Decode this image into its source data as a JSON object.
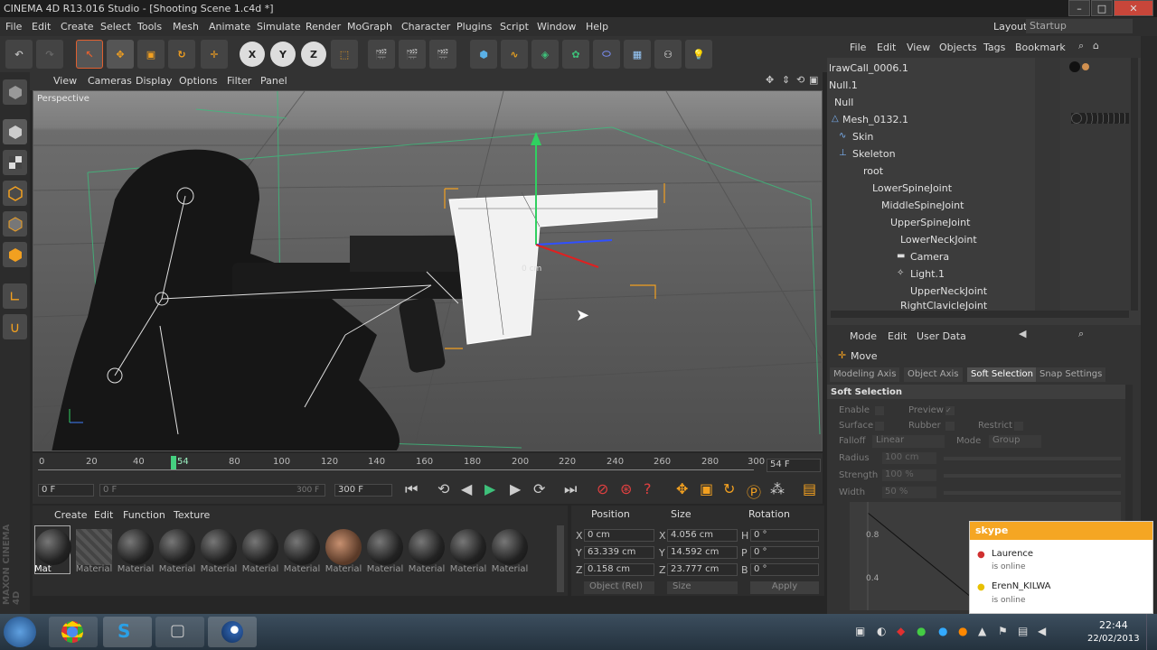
{
  "window": {
    "title": "CINEMA 4D R13.016 Studio - [Shooting Scene 1.c4d *]",
    "layout_label": "Layout:",
    "layout_value": "Startup"
  },
  "menu": [
    "File",
    "Edit",
    "Create",
    "Select",
    "Tools",
    "Mesh",
    "Animate",
    "Simulate",
    "Render",
    "MoGraph",
    "Character",
    "Plugins",
    "Script",
    "Window",
    "Help"
  ],
  "toolbar": {
    "axis_x": "X",
    "axis_y": "Y",
    "axis_z": "Z"
  },
  "viewport": {
    "menu": [
      "View",
      "Cameras",
      "Display",
      "Options",
      "Filter",
      "Panel"
    ],
    "label": "Perspective",
    "gizmo_readout": "0 cm"
  },
  "timeline": {
    "ticks": [
      "0",
      "20",
      "40",
      "54",
      "80",
      "100",
      "120",
      "140",
      "160",
      "180",
      "200",
      "220",
      "240",
      "260",
      "280",
      "300"
    ],
    "current_frame": "54 F"
  },
  "transport": {
    "start": "0 F",
    "range_start": "0 F",
    "range_end": "300 F",
    "end": "300 F"
  },
  "materials": {
    "menu": [
      "Create",
      "Edit",
      "Function",
      "Texture"
    ],
    "items": [
      "Mat",
      "Material",
      "Material",
      "Material",
      "Material",
      "Material",
      "Material",
      "Material",
      "Material",
      "Material",
      "Material",
      "Material"
    ]
  },
  "coords": {
    "headers": [
      "Position",
      "Size",
      "Rotation"
    ],
    "rows": [
      {
        "axis": "X",
        "pos": "0 cm",
        "size_axis": "X",
        "size": "4.056 cm",
        "rot_axis": "H",
        "rot": "0 °"
      },
      {
        "axis": "Y",
        "pos": "63.339 cm",
        "size_axis": "Y",
        "size": "14.592 cm",
        "rot_axis": "P",
        "rot": "0 °"
      },
      {
        "axis": "Z",
        "pos": "0.158 cm",
        "size_axis": "Z",
        "size": "23.777 cm",
        "rot_axis": "B",
        "rot": "0 °"
      }
    ],
    "mode": "Object (Rel)",
    "size_mode": "Size",
    "apply": "Apply"
  },
  "objects": {
    "menu": [
      "File",
      "Edit",
      "View",
      "Objects",
      "Tags",
      "Bookmark"
    ],
    "rows": [
      "lrawCall_0006.1",
      "Null.1",
      "Null",
      "Mesh_0132.1",
      "Skin",
      "Skeleton",
      "root",
      "LowerSpineJoint",
      "MiddleSpineJoint",
      "UpperSpineJoint",
      "LowerNeckJoint",
      "Camera",
      "Light.1",
      "UpperNeckJoint",
      "RightClavicleJoint"
    ]
  },
  "attributes": {
    "menu": [
      "Mode",
      "Edit",
      "User Data"
    ],
    "tool": "Move",
    "tabs": [
      "Modeling Axis",
      "Object Axis",
      "Soft Selection",
      "Snap Settings"
    ],
    "section": "Soft Selection",
    "labels": {
      "enable": "Enable",
      "preview": "Preview",
      "surface": "Surface",
      "rubber": "Rubber",
      "restrict": "Restrict",
      "falloff": "Falloff",
      "falloff_val": "Linear",
      "mode": "Mode",
      "mode_val": "Group",
      "radius": "Radius",
      "radius_val": "100 cm",
      "strength": "Strength",
      "strength_val": "100 %",
      "width": "Width",
      "width_val": "50 %"
    },
    "graph_ticks": [
      "0.8",
      "0.4"
    ]
  },
  "skype": {
    "brand": "skype",
    "contacts": [
      {
        "name": "Laurence",
        "status": "is online"
      },
      {
        "name": "ErenN_KILWA",
        "status": "is online"
      }
    ]
  },
  "taskbar": {
    "time": "22:44",
    "date": "22/02/2013"
  },
  "sidebar_brand": "MAXON CINEMA 4D"
}
